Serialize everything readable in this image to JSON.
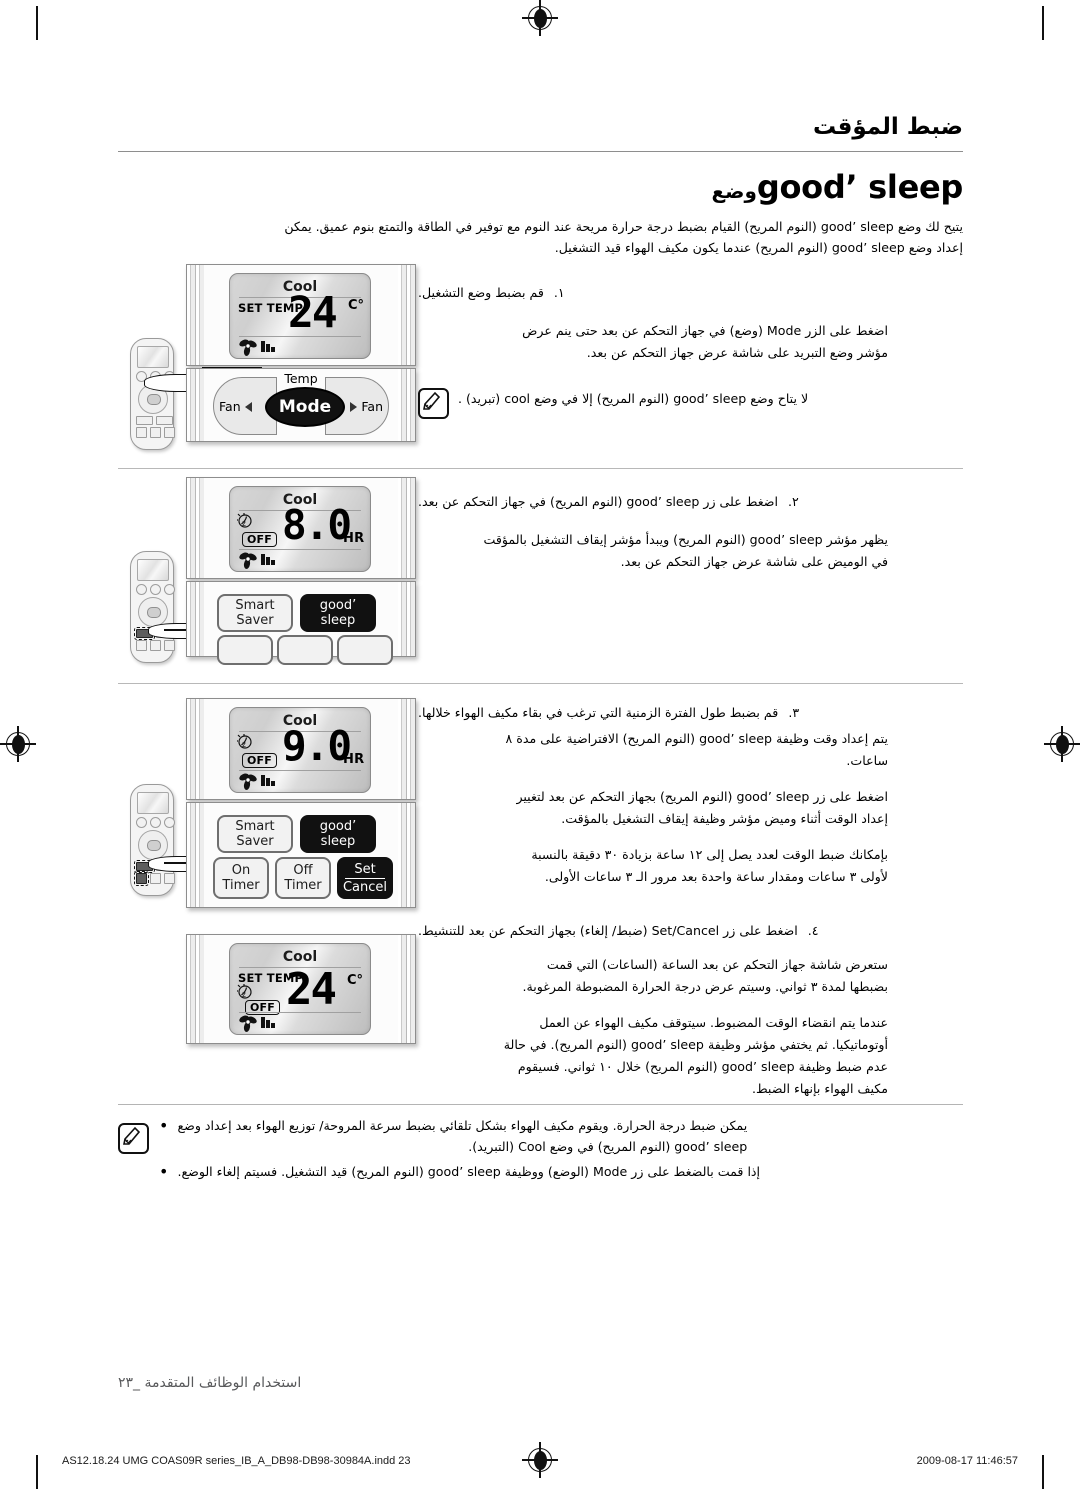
{
  "header": {
    "chapter_title": "ضبط المؤقت",
    "section_title_ar": "وضع",
    "section_title_en": "good’ sleep"
  },
  "intro": {
    "line1": "يتيح لك وضع good’ sleep (النوم المريح) القيام بضبط درجة حرارة مريحة عند النوم مع توفير في الطاقة والتمتع بنوم عميق. يمكن",
    "line2": "إعداد وضع good’ sleep (النوم المريح) عندما يكون مكيف الهواء قيد التشغيل."
  },
  "steps": [
    {
      "num": "١.",
      "title": "قم بضبط وضع التشغيل.",
      "paras": [
        "اضغط على الزر Mode (وضع) في جهاز التحكم عن بعد حتى ينم عرض",
        "مؤشر وضع التبريد على شاشة عرض جهاز التحكم عن بعد."
      ],
      "note": "لا يتاح وضع good’ sleep (النوم المريح) إلا في وضع cool (تبريد) ."
    },
    {
      "num": "٢.",
      "title": "اضغط على زر good’ sleep (النوم المريح) في جهاز التحكم عن بعد.",
      "paras": [
        "يظهر مؤشر good’ sleep (النوم المريح) ويبدأ مؤشر إيقاف التشغيل بالمؤقت",
        "في الوميض على شاشة عرض جهاز التحكم عن بعد."
      ]
    },
    {
      "num": "٣.",
      "title": "قم بضبط طول الفترة الزمنية التي ترغب في بقاء مكيف الهواء خلالها.",
      "paras": [
        "يتم إعداد وقت وظيفة good’ sleep (النوم المريح) الافتراضية على مدة ٨",
        "ساعات.",
        "اضغط على زر good’ sleep (النوم المريح) بجهاز التحكم عن بعد لتغيير",
        "إعداد الوقت أثناء وميض مؤشر وظيفة إيقاف التشغيل بالمؤقت.",
        "بإمكانك ضبط الوقت لعدد يصل إلى ١٢ ساعة بزيادة ٣٠ دقيقة بالنسبة",
        "لأولى ٣ ساعات ومقدار ساعة واحدة بعد مرور الـ ٣ ساعات الأولى."
      ]
    },
    {
      "num": "٤.",
      "title": "اضغط على زر Set/Cancel (ضبط/ إلغاء) بجهاز التحكم عن بعد للتنشيط.",
      "paras": [
        "ستعرض شاشة جهاز التحكم عن بعد الساعة (الساعات) التي قمت",
        "بضبطها لمدة ٣ ثواني. وسيتم عرض درجة الحرارة المضبوطة المرغوبة.",
        "عندما يتم انقضاء الوقت المضبوط. سيتوقف مكيف الهواء عن العمل",
        "أوتوماتيكيا. ثم يختفي مؤشر وظيفة good’ sleep (النوم المريح). في حالة",
        "عدم ضبط وظيفة good’ sleep (النوم المريح) خلال ١٠ ثواني. فسيقوم",
        "مكيف الهواء بإنهاء الضبط."
      ]
    }
  ],
  "bottom_notes": [
    {
      "bullet": "•",
      "lines": [
        "يمكن ضبط درجة الحرارة. ويقوم مكيف الهواء بشكل تلقائي بضبط سرعة المروحة/ توزيع الهواء بعد إعداد وضع",
        "good’ sleep (النوم المريح) في وضع Cool (التبريد)."
      ]
    },
    {
      "bullet": "•",
      "lines": [
        "إذا قمت بالضغط على زر Mode (الوضع) ووظيفة good’ sleep (النوم المريح) قيد التشغيل. فسيتم إلغاء الوضع."
      ]
    }
  ],
  "illustrations": [
    {
      "id": "illus-1",
      "screen": {
        "mode": "Cool",
        "set_temp_label": "SET TEMP",
        "value": "24",
        "unit": "°C",
        "off_label": null,
        "hr_label": null
      },
      "controls": {
        "temp_label": "Temp",
        "fan_left": "Fan",
        "fan_right": "Fan",
        "center_button": "Mode"
      }
    },
    {
      "id": "illus-2",
      "screen": {
        "mode": "Cool",
        "set_temp_label": null,
        "value": "8.0",
        "unit": null,
        "off_label": "OFF",
        "hr_label": "HR"
      },
      "controls": {
        "smart_saver": "Smart Saver",
        "good_sleep": "good’ sleep"
      }
    },
    {
      "id": "illus-3",
      "screen": {
        "mode": "Cool",
        "set_temp_label": null,
        "value": "9.0",
        "unit": null,
        "off_label": "OFF",
        "hr_label": "HR"
      },
      "controls": {
        "smart_saver": "Smart Saver",
        "good_sleep": "good’ sleep",
        "on_timer_l1": "On",
        "on_timer_l2": "Timer",
        "off_timer_l1": "Off",
        "off_timer_l2": "Timer",
        "set_l1": "Set",
        "set_l2": "Cancel"
      }
    },
    {
      "id": "illus-4",
      "screen": {
        "mode": "Cool",
        "set_temp_label": "SET TEMP",
        "value": "24",
        "unit": "°C",
        "off_label": "OFF",
        "hr_label": null
      }
    }
  ],
  "footer": {
    "page_label": "استخدام الوظائف المتقدمة _٢٣",
    "print_left": "AS12.18.24 UMG COAS09R series_IB_A_DB98-DB98-30984A.indd   23",
    "print_right": "2009-08-17   11:46:57"
  },
  "colors": {
    "rule": "#8e8e8e",
    "footer_text": "#58595b",
    "button_dark": "#5b5b5b",
    "button_black": "#111111"
  }
}
